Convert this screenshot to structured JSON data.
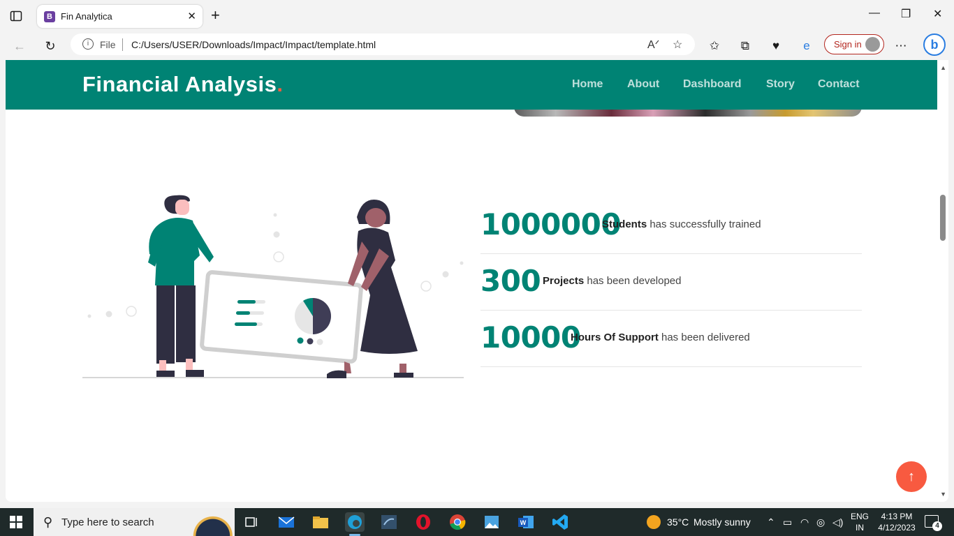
{
  "browser": {
    "tab_title": "Fin Analytica",
    "tab_favicon": "B",
    "address_scheme": "File",
    "address_url": "C:/Users/USER/Downloads/Impact/Impact/template.html",
    "signin_label": "Sign in"
  },
  "site": {
    "logo_text": "Financial Analysis",
    "logo_dot": ".",
    "nav": [
      "Home",
      "About",
      "Dashboard",
      "Story",
      "Contact"
    ]
  },
  "stats": [
    {
      "number": "1000000",
      "bold": "Students",
      "text": " has successfully trained"
    },
    {
      "number": "300",
      "bold": "Projects",
      "text": " has been developed"
    },
    {
      "number": "10000",
      "bold": "Hours Of Support",
      "text": " has been delivered"
    }
  ],
  "colors": {
    "brand": "#008374",
    "accent": "#f85a40"
  },
  "taskbar": {
    "search_placeholder": "Type here to search",
    "weather_temp": "35°C",
    "weather_desc": "Mostly sunny",
    "lang_line1": "ENG",
    "lang_line2": "IN",
    "time": "4:13 PM",
    "date": "4/12/2023",
    "notification_count": "4"
  }
}
